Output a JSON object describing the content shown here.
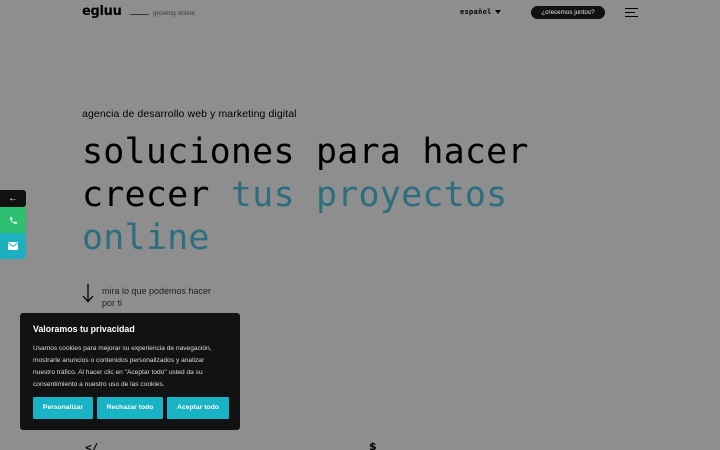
{
  "header": {
    "logo": "egluu",
    "tagline": "growing online",
    "language": "español",
    "cta_label": "¿crecemos juntos?"
  },
  "hero": {
    "subtitle": "agencia de desarrollo web y marketing digital",
    "line1": "soluciones para hacer",
    "line2_plain": "crecer ",
    "line2_accent": "tus proyectos",
    "line3_accent": "online",
    "scroll_text": "mira lo que podemos hacer por ti"
  },
  "side": {
    "back_arrow": "←",
    "phone_icon": "phone-icon",
    "mail_icon": "mail-icon"
  },
  "cookie": {
    "title": "Valoramos tu privacidad",
    "text": "Usamos cookies para mejorar su experiencia de navegación, mostrarle anuncios o contenidos personalizados y analizar nuestro tráfico. Al hacer clic en \"Aceptar todo\" usted da su consentimiento a nuestro uso de las cookies.",
    "customize_label": "Personalizar",
    "reject_label": "Rechazar todo",
    "accept_label": "Aceptar todo"
  },
  "bottom": {
    "code_glyph": "</",
    "dollar_glyph": "$"
  },
  "colors": {
    "overlay_bg": "#8e8e8e",
    "accent_text": "#2d6e7e",
    "cookie_button": "#19b3c6",
    "phone_button": "#2fbf71",
    "mail_button": "#1fb0c0"
  }
}
